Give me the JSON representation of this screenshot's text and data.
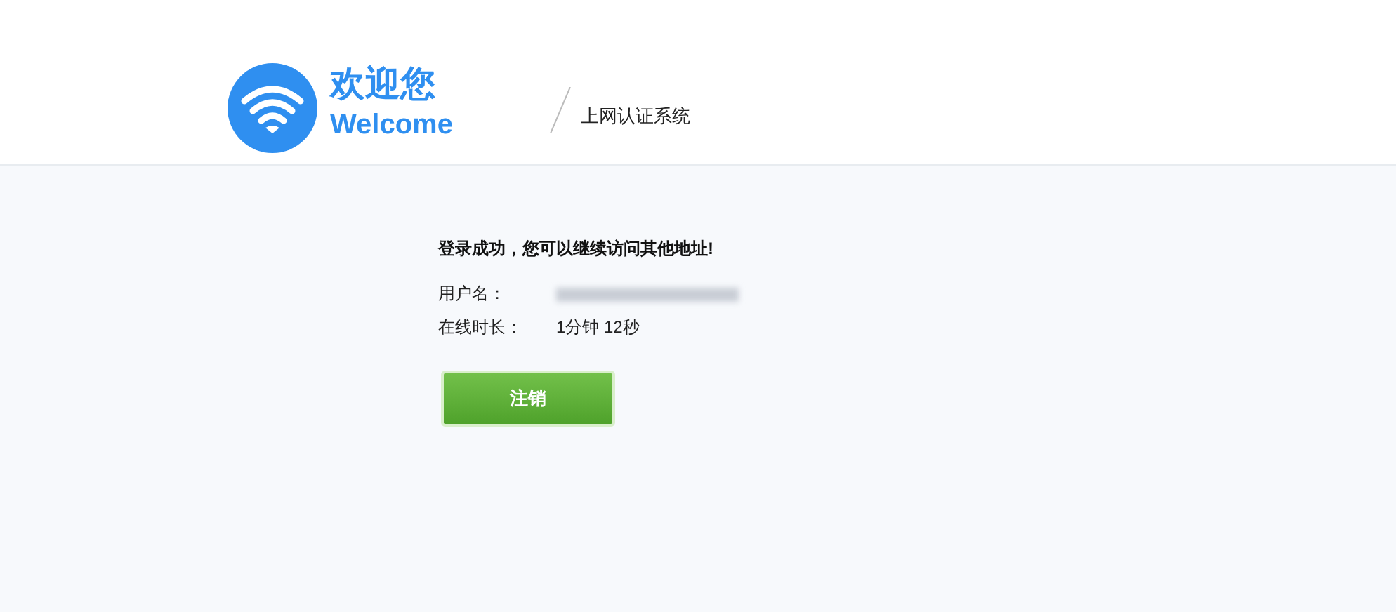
{
  "header": {
    "greeting": "欢迎您",
    "welcome": "Welcome",
    "system_title": "上网认证系统"
  },
  "message": "登录成功，您可以继续访问其他地址!",
  "fields": [
    {
      "label": "用户名：",
      "kind": "redacted"
    },
    {
      "label": "在线时长：",
      "kind": "text",
      "value": "1分钟 12秒"
    }
  ],
  "logout_button": "注销"
}
